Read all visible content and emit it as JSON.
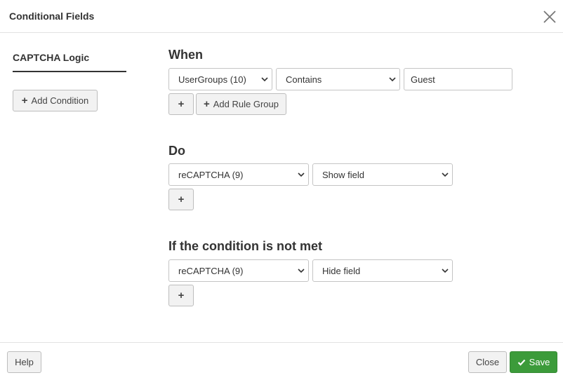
{
  "dialog": {
    "title": "Conditional Fields",
    "close_icon": "close-icon"
  },
  "sidebar": {
    "tab_label": "CAPTCHA Logic",
    "add_condition_label": "Add Condition"
  },
  "when": {
    "heading": "When",
    "field_select": "UserGroups (10)",
    "operator_select": "Contains",
    "value_input": "Guest",
    "add_rule_group_label": "Add Rule Group"
  },
  "do": {
    "heading": "Do",
    "field_select": "reCAPTCHA (9)",
    "action_select": "Show field"
  },
  "else": {
    "heading": "If the condition is not met",
    "field_select": "reCAPTCHA (9)",
    "action_select": "Hide field"
  },
  "footer": {
    "help_label": "Help",
    "close_label": "Close",
    "save_label": "Save"
  },
  "colors": {
    "save_button": "#3c9b3a",
    "button_bg": "#f2f2f2"
  }
}
